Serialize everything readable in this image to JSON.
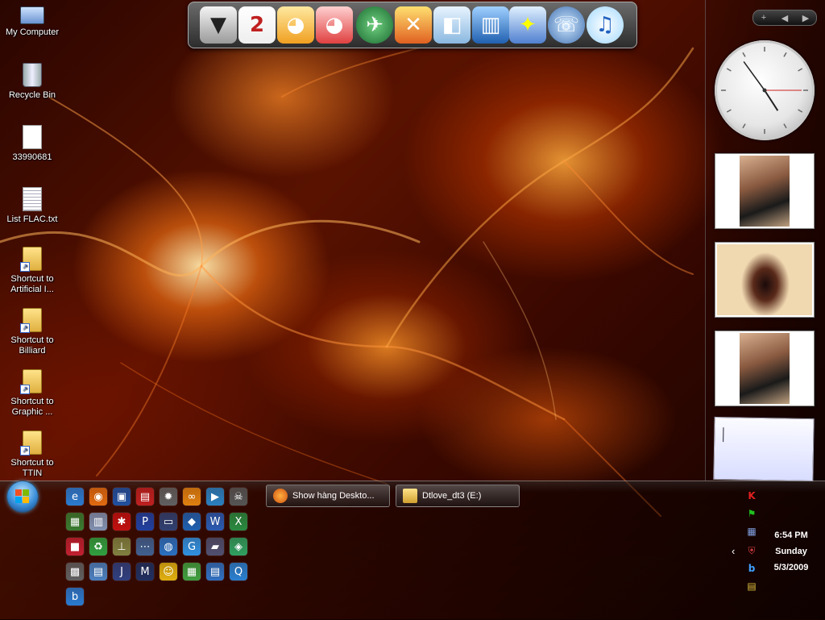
{
  "desktop": {
    "icons": [
      {
        "label": "My Computer",
        "icon": "computer-icon"
      },
      {
        "label": "Recycle Bin",
        "icon": "recycle-bin-icon"
      },
      {
        "label": "33990681",
        "icon": "file-icon"
      },
      {
        "label": "List FLAC.txt",
        "icon": "text-file-icon"
      },
      {
        "label": "Shortcut to Artificial I...",
        "icon": "folder-shortcut-icon"
      },
      {
        "label": "Shortcut to Billiard",
        "icon": "folder-shortcut-icon"
      },
      {
        "label": "Shortcut to Graphic ...",
        "icon": "folder-shortcut-icon"
      },
      {
        "label": "Shortcut to TTIN",
        "icon": "folder-shortcut-icon"
      }
    ]
  },
  "dock": {
    "items": [
      {
        "icon": "fox-mask-icon",
        "color": "#d8d8d8"
      },
      {
        "icon": "chicken-2-icon",
        "color": "#c02020"
      },
      {
        "icon": "chicken-invaders-icon",
        "color": "#f0b020"
      },
      {
        "icon": "chicken-invaders-xmas-icon",
        "color": "#e04040"
      },
      {
        "icon": "jump-game-icon",
        "color": "#2a9a40"
      },
      {
        "icon": "xmind-icon",
        "color": "#e06020"
      },
      {
        "icon": "cube-icon",
        "color": "#a8d0f0"
      },
      {
        "icon": "books-icon",
        "color": "#3070c0"
      },
      {
        "icon": "magic-wand-icon",
        "color": "#5080d0"
      },
      {
        "icon": "phone-icon",
        "color": "#4070b0"
      },
      {
        "icon": "itunes-icon",
        "color": "#40a0e0"
      }
    ]
  },
  "sidebar": {
    "controls": [
      "+",
      "◀",
      "▶"
    ],
    "clock": {
      "hour": 4,
      "minute": 54,
      "second": 15
    }
  },
  "taskbar": {
    "tasks": [
      {
        "label": "Show hàng Deskto...",
        "icon": "firefox-icon"
      },
      {
        "label": "Dtlove_dt3 (E:)",
        "icon": "folder-icon"
      }
    ],
    "quicklaunch": [
      {
        "icon": "internet-explorer-icon",
        "glyph": "e",
        "color": "#2a7ad0"
      },
      {
        "icon": "firefox-icon",
        "glyph": "◉",
        "color": "#e06a10"
      },
      {
        "icon": "app-window-icon",
        "glyph": "▣",
        "color": "#2050a0"
      },
      {
        "icon": "toolbox-icon",
        "glyph": "▤",
        "color": "#c02020"
      },
      {
        "icon": "gear-app-icon",
        "glyph": "✹",
        "color": "#606060"
      },
      {
        "icon": "chain-icon",
        "glyph": "∞",
        "color": "#e08010"
      },
      {
        "icon": "media-player-icon",
        "glyph": "▶",
        "color": "#2a80c0"
      },
      {
        "icon": "skull-icon",
        "glyph": "☠",
        "color": "#555555"
      },
      {
        "icon": "photo-app-icon",
        "glyph": "▦",
        "color": "#3a7a30"
      },
      {
        "icon": "calculator-icon",
        "glyph": "▥",
        "color": "#8090b0"
      },
      {
        "icon": "star-app-icon",
        "glyph": "✱",
        "color": "#c01010"
      },
      {
        "icon": "pe-tool-icon",
        "glyph": "P",
        "color": "#2040a0"
      },
      {
        "icon": "monitor-icon",
        "glyph": "▭",
        "color": "#304070"
      },
      {
        "icon": "blue-app-icon",
        "glyph": "◆",
        "color": "#2060b0"
      },
      {
        "icon": "word-icon",
        "glyph": "W",
        "color": "#2a5ab0"
      },
      {
        "icon": "excel-icon",
        "glyph": "X",
        "color": "#2a8a40"
      },
      {
        "icon": "red-square-icon",
        "glyph": "■",
        "color": "#c02030"
      },
      {
        "icon": "recycle-icon",
        "glyph": "♻",
        "color": "#30a040"
      },
      {
        "icon": "usb-icon",
        "glyph": "⊥",
        "color": "#808040"
      },
      {
        "icon": "network-icon",
        "glyph": "⋯",
        "color": "#406090"
      },
      {
        "icon": "globe-icon",
        "glyph": "◍",
        "color": "#2a70c0"
      },
      {
        "icon": "g-app-icon",
        "glyph": "G",
        "color": "#3090e0"
      },
      {
        "icon": "camera-icon",
        "glyph": "▰",
        "color": "#505070"
      },
      {
        "icon": "green-app-icon",
        "glyph": "◈",
        "color": "#30a060"
      },
      {
        "icon": "qr-icon",
        "glyph": "▩",
        "color": "#606060"
      },
      {
        "icon": "printer-icon",
        "glyph": "▤",
        "color": "#4a80c0"
      },
      {
        "icon": "j-app-icon",
        "glyph": "J",
        "color": "#304080"
      },
      {
        "icon": "motorola-icon",
        "glyph": "M",
        "color": "#203060"
      },
      {
        "icon": "smiley-icon",
        "glyph": "☺",
        "color": "#e0b010"
      },
      {
        "icon": "keyboard-icon",
        "glyph": "▦",
        "color": "#40a040"
      },
      {
        "icon": "document-app-icon",
        "glyph": "▤",
        "color": "#3070c0"
      },
      {
        "icon": "q-app-icon",
        "glyph": "Q",
        "color": "#2a80d0"
      },
      {
        "icon": "b-app-icon",
        "glyph": "b",
        "color": "#2a7ad0"
      }
    ],
    "tray": {
      "icons": [
        "kaspersky-icon",
        "green-flag-icon",
        "network-icon",
        "shield-icon",
        "b-tray-icon",
        "flag-app-icon"
      ],
      "time": "6:54 PM",
      "day": "Sunday",
      "date": "5/3/2009"
    }
  }
}
